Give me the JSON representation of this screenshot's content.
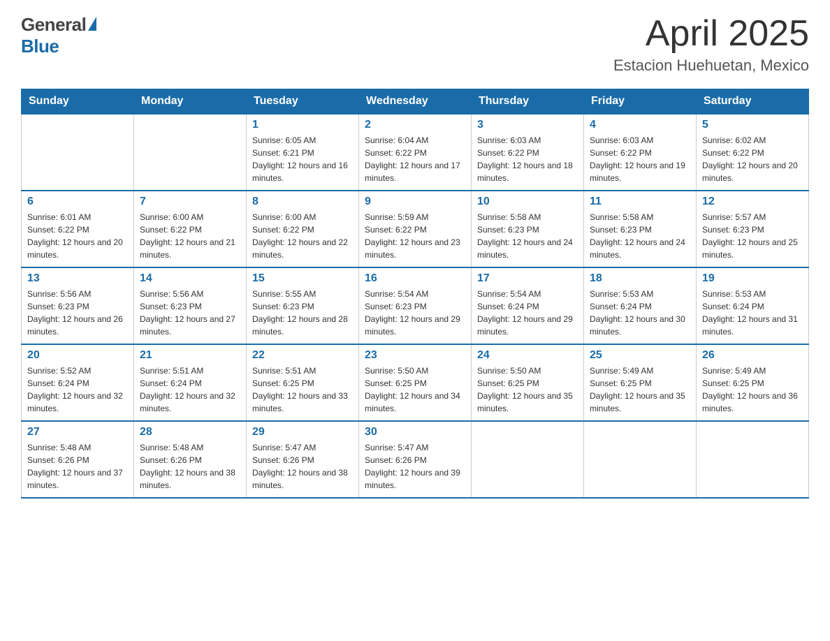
{
  "header": {
    "logo_general": "General",
    "logo_blue": "Blue",
    "title": "April 2025",
    "subtitle": "Estacion Huehuetan, Mexico"
  },
  "days_of_week": [
    "Sunday",
    "Monday",
    "Tuesday",
    "Wednesday",
    "Thursday",
    "Friday",
    "Saturday"
  ],
  "weeks": [
    [
      {
        "day": "",
        "sunrise": "",
        "sunset": "",
        "daylight": ""
      },
      {
        "day": "",
        "sunrise": "",
        "sunset": "",
        "daylight": ""
      },
      {
        "day": "1",
        "sunrise": "Sunrise: 6:05 AM",
        "sunset": "Sunset: 6:21 PM",
        "daylight": "Daylight: 12 hours and 16 minutes."
      },
      {
        "day": "2",
        "sunrise": "Sunrise: 6:04 AM",
        "sunset": "Sunset: 6:22 PM",
        "daylight": "Daylight: 12 hours and 17 minutes."
      },
      {
        "day": "3",
        "sunrise": "Sunrise: 6:03 AM",
        "sunset": "Sunset: 6:22 PM",
        "daylight": "Daylight: 12 hours and 18 minutes."
      },
      {
        "day": "4",
        "sunrise": "Sunrise: 6:03 AM",
        "sunset": "Sunset: 6:22 PM",
        "daylight": "Daylight: 12 hours and 19 minutes."
      },
      {
        "day": "5",
        "sunrise": "Sunrise: 6:02 AM",
        "sunset": "Sunset: 6:22 PM",
        "daylight": "Daylight: 12 hours and 20 minutes."
      }
    ],
    [
      {
        "day": "6",
        "sunrise": "Sunrise: 6:01 AM",
        "sunset": "Sunset: 6:22 PM",
        "daylight": "Daylight: 12 hours and 20 minutes."
      },
      {
        "day": "7",
        "sunrise": "Sunrise: 6:00 AM",
        "sunset": "Sunset: 6:22 PM",
        "daylight": "Daylight: 12 hours and 21 minutes."
      },
      {
        "day": "8",
        "sunrise": "Sunrise: 6:00 AM",
        "sunset": "Sunset: 6:22 PM",
        "daylight": "Daylight: 12 hours and 22 minutes."
      },
      {
        "day": "9",
        "sunrise": "Sunrise: 5:59 AM",
        "sunset": "Sunset: 6:22 PM",
        "daylight": "Daylight: 12 hours and 23 minutes."
      },
      {
        "day": "10",
        "sunrise": "Sunrise: 5:58 AM",
        "sunset": "Sunset: 6:23 PM",
        "daylight": "Daylight: 12 hours and 24 minutes."
      },
      {
        "day": "11",
        "sunrise": "Sunrise: 5:58 AM",
        "sunset": "Sunset: 6:23 PM",
        "daylight": "Daylight: 12 hours and 24 minutes."
      },
      {
        "day": "12",
        "sunrise": "Sunrise: 5:57 AM",
        "sunset": "Sunset: 6:23 PM",
        "daylight": "Daylight: 12 hours and 25 minutes."
      }
    ],
    [
      {
        "day": "13",
        "sunrise": "Sunrise: 5:56 AM",
        "sunset": "Sunset: 6:23 PM",
        "daylight": "Daylight: 12 hours and 26 minutes."
      },
      {
        "day": "14",
        "sunrise": "Sunrise: 5:56 AM",
        "sunset": "Sunset: 6:23 PM",
        "daylight": "Daylight: 12 hours and 27 minutes."
      },
      {
        "day": "15",
        "sunrise": "Sunrise: 5:55 AM",
        "sunset": "Sunset: 6:23 PM",
        "daylight": "Daylight: 12 hours and 28 minutes."
      },
      {
        "day": "16",
        "sunrise": "Sunrise: 5:54 AM",
        "sunset": "Sunset: 6:23 PM",
        "daylight": "Daylight: 12 hours and 29 minutes."
      },
      {
        "day": "17",
        "sunrise": "Sunrise: 5:54 AM",
        "sunset": "Sunset: 6:24 PM",
        "daylight": "Daylight: 12 hours and 29 minutes."
      },
      {
        "day": "18",
        "sunrise": "Sunrise: 5:53 AM",
        "sunset": "Sunset: 6:24 PM",
        "daylight": "Daylight: 12 hours and 30 minutes."
      },
      {
        "day": "19",
        "sunrise": "Sunrise: 5:53 AM",
        "sunset": "Sunset: 6:24 PM",
        "daylight": "Daylight: 12 hours and 31 minutes."
      }
    ],
    [
      {
        "day": "20",
        "sunrise": "Sunrise: 5:52 AM",
        "sunset": "Sunset: 6:24 PM",
        "daylight": "Daylight: 12 hours and 32 minutes."
      },
      {
        "day": "21",
        "sunrise": "Sunrise: 5:51 AM",
        "sunset": "Sunset: 6:24 PM",
        "daylight": "Daylight: 12 hours and 32 minutes."
      },
      {
        "day": "22",
        "sunrise": "Sunrise: 5:51 AM",
        "sunset": "Sunset: 6:25 PM",
        "daylight": "Daylight: 12 hours and 33 minutes."
      },
      {
        "day": "23",
        "sunrise": "Sunrise: 5:50 AM",
        "sunset": "Sunset: 6:25 PM",
        "daylight": "Daylight: 12 hours and 34 minutes."
      },
      {
        "day": "24",
        "sunrise": "Sunrise: 5:50 AM",
        "sunset": "Sunset: 6:25 PM",
        "daylight": "Daylight: 12 hours and 35 minutes."
      },
      {
        "day": "25",
        "sunrise": "Sunrise: 5:49 AM",
        "sunset": "Sunset: 6:25 PM",
        "daylight": "Daylight: 12 hours and 35 minutes."
      },
      {
        "day": "26",
        "sunrise": "Sunrise: 5:49 AM",
        "sunset": "Sunset: 6:25 PM",
        "daylight": "Daylight: 12 hours and 36 minutes."
      }
    ],
    [
      {
        "day": "27",
        "sunrise": "Sunrise: 5:48 AM",
        "sunset": "Sunset: 6:26 PM",
        "daylight": "Daylight: 12 hours and 37 minutes."
      },
      {
        "day": "28",
        "sunrise": "Sunrise: 5:48 AM",
        "sunset": "Sunset: 6:26 PM",
        "daylight": "Daylight: 12 hours and 38 minutes."
      },
      {
        "day": "29",
        "sunrise": "Sunrise: 5:47 AM",
        "sunset": "Sunset: 6:26 PM",
        "daylight": "Daylight: 12 hours and 38 minutes."
      },
      {
        "day": "30",
        "sunrise": "Sunrise: 5:47 AM",
        "sunset": "Sunset: 6:26 PM",
        "daylight": "Daylight: 12 hours and 39 minutes."
      },
      {
        "day": "",
        "sunrise": "",
        "sunset": "",
        "daylight": ""
      },
      {
        "day": "",
        "sunrise": "",
        "sunset": "",
        "daylight": ""
      },
      {
        "day": "",
        "sunrise": "",
        "sunset": "",
        "daylight": ""
      }
    ]
  ]
}
